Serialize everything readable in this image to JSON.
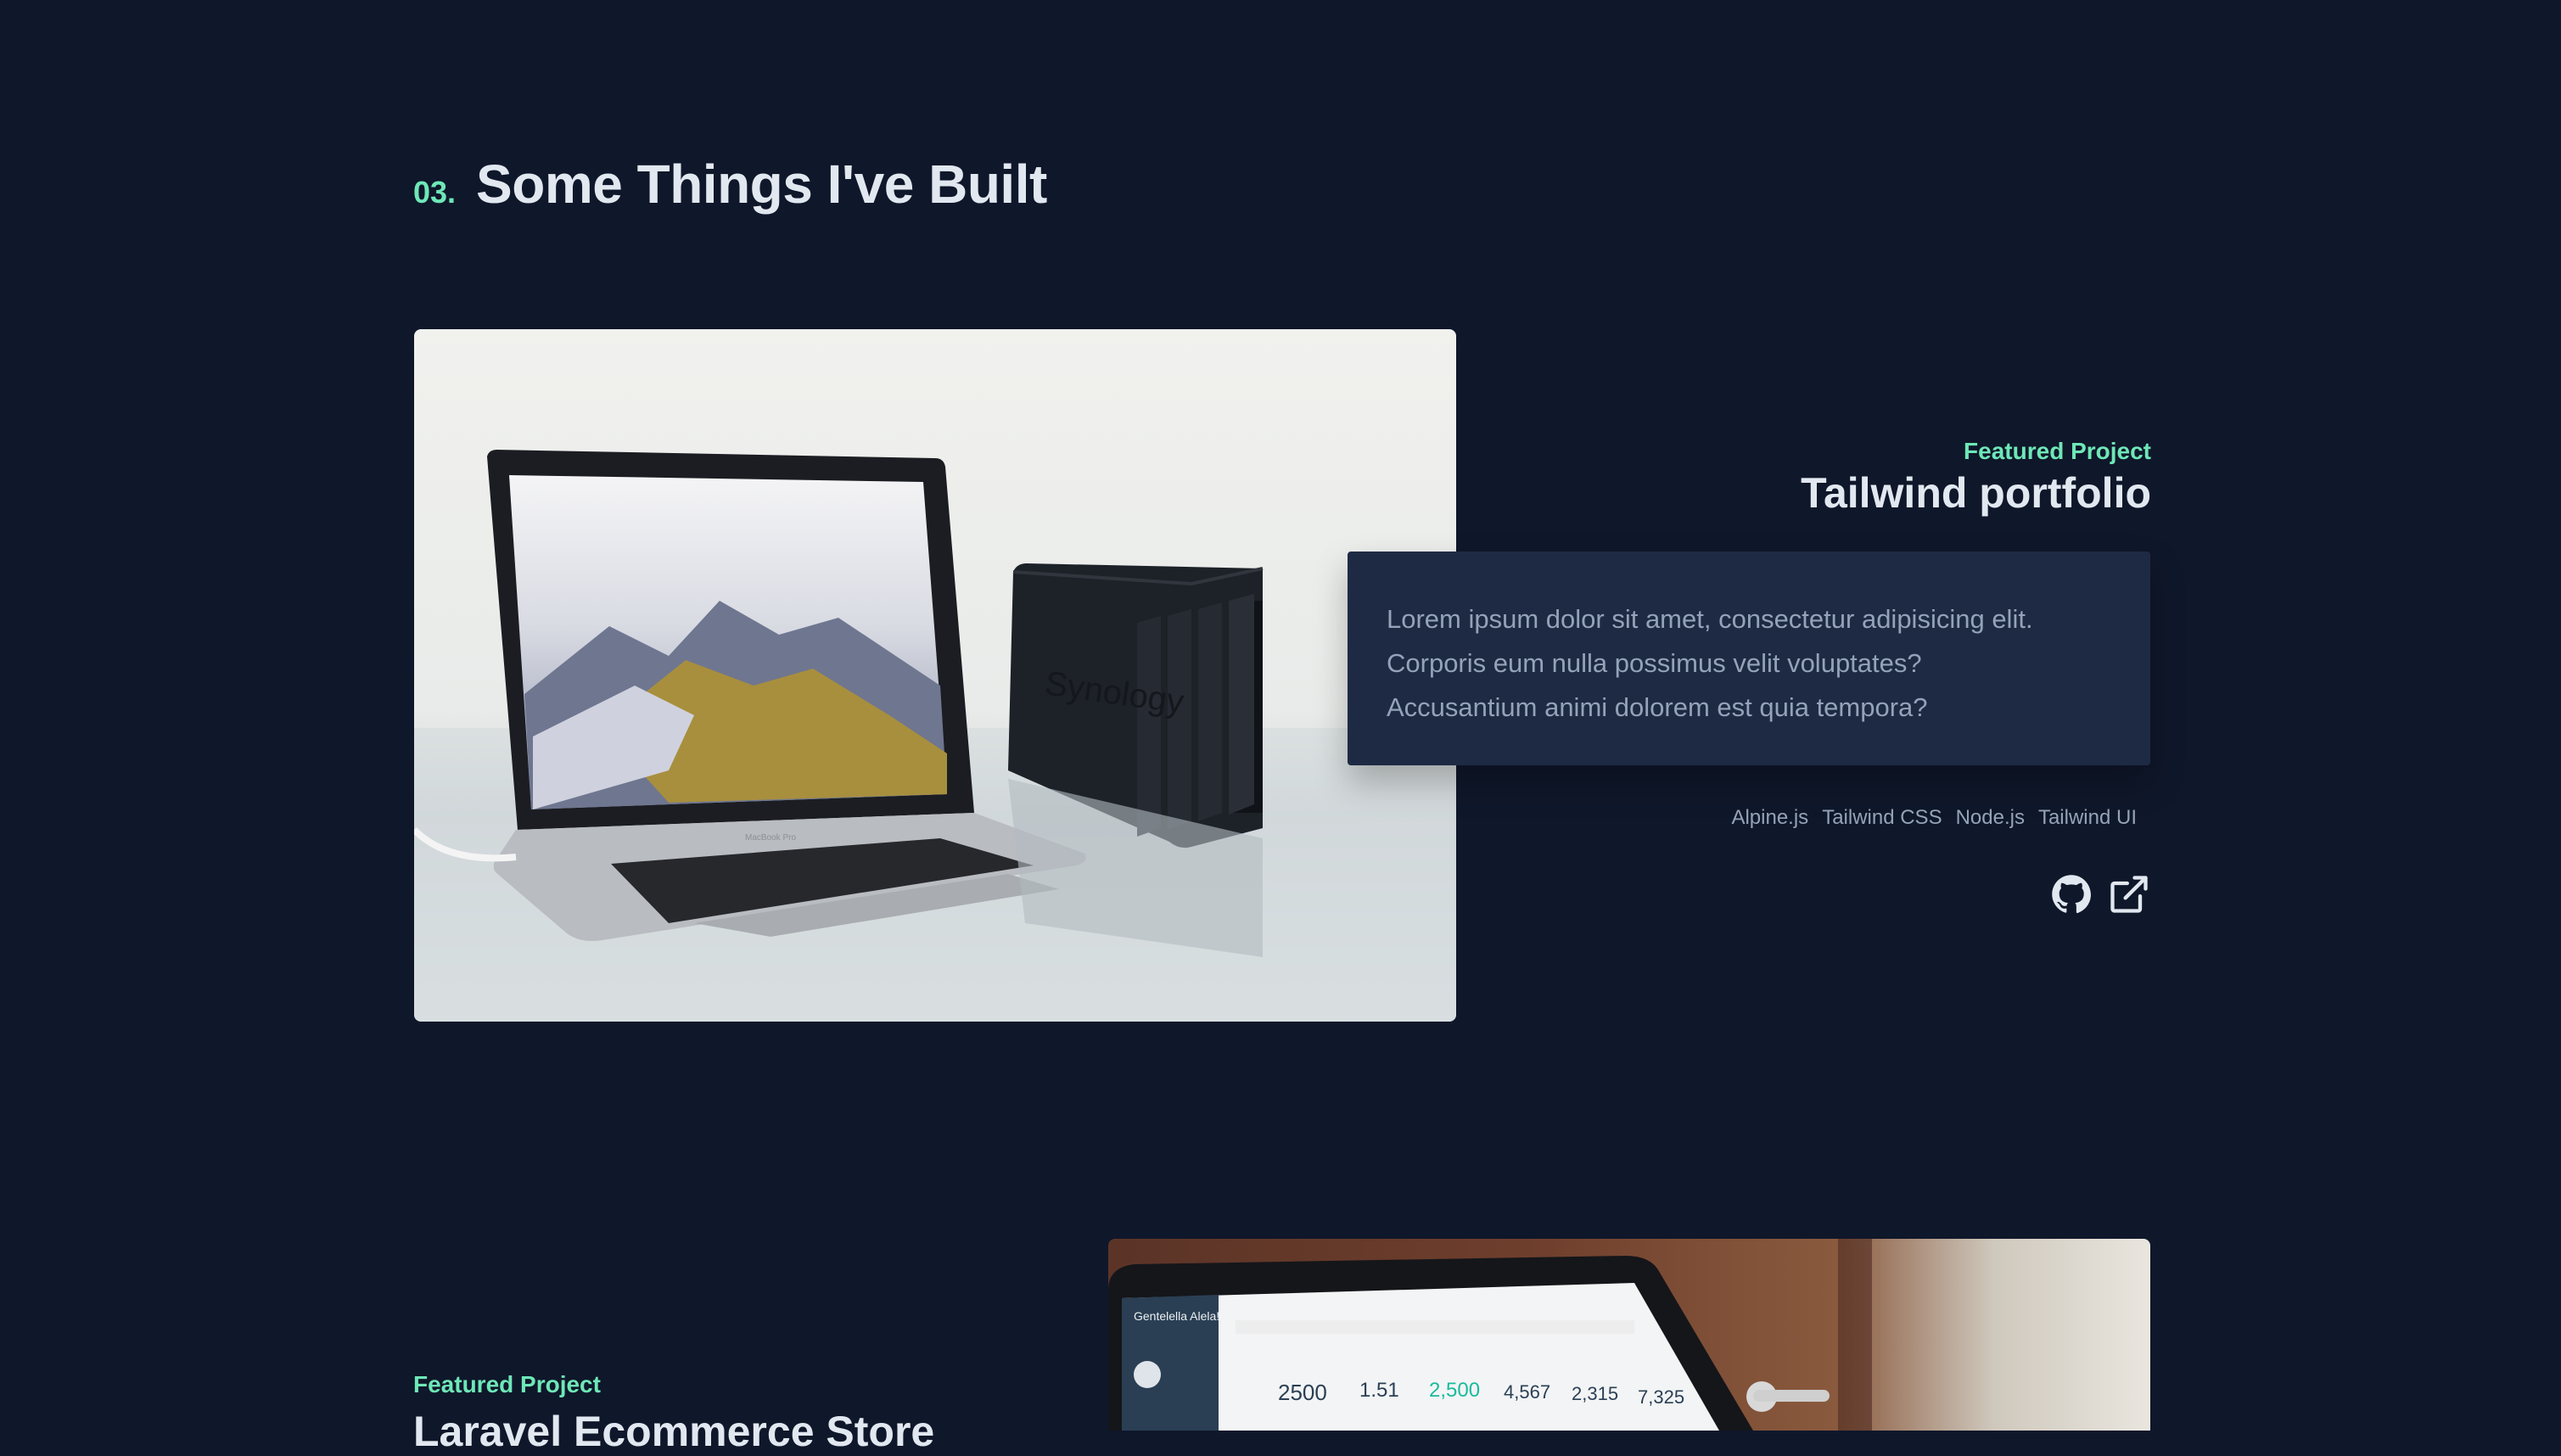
{
  "section": {
    "number": "03.",
    "title": "Some Things I've Built"
  },
  "projects": [
    {
      "eyebrow": "Featured Project",
      "title": "Tailwind portfolio",
      "description_lines": [
        "Lorem ipsum dolor sit amet, consectetur adipisicing elit.",
        "Corporis eum nulla possimus velit voluptates?",
        "Accusantium animi dolorem est quia tempora?"
      ],
      "tech": [
        "Alpine.js",
        "Tailwind CSS",
        "Node.js",
        "Tailwind UI"
      ],
      "links": [
        {
          "icon": "github-icon"
        },
        {
          "icon": "external-link-icon"
        }
      ],
      "image": {
        "laptop_label": "MacBook Pro",
        "device_label": "Synology"
      }
    },
    {
      "eyebrow": "Featured Project",
      "title": "Laravel Ecommerce Store",
      "image": {
        "dashboard_brand": "Gentelella Alela!",
        "dashboard_stats": [
          "2500",
          "1.51",
          "2,500",
          "4,567",
          "2,315",
          "7,325"
        ]
      }
    }
  ],
  "colors": {
    "background": "#0f172a",
    "accent": "#6ee7b7",
    "heading": "#e2e8f0",
    "muted": "#94a3b8",
    "card": "#1e2a44"
  }
}
